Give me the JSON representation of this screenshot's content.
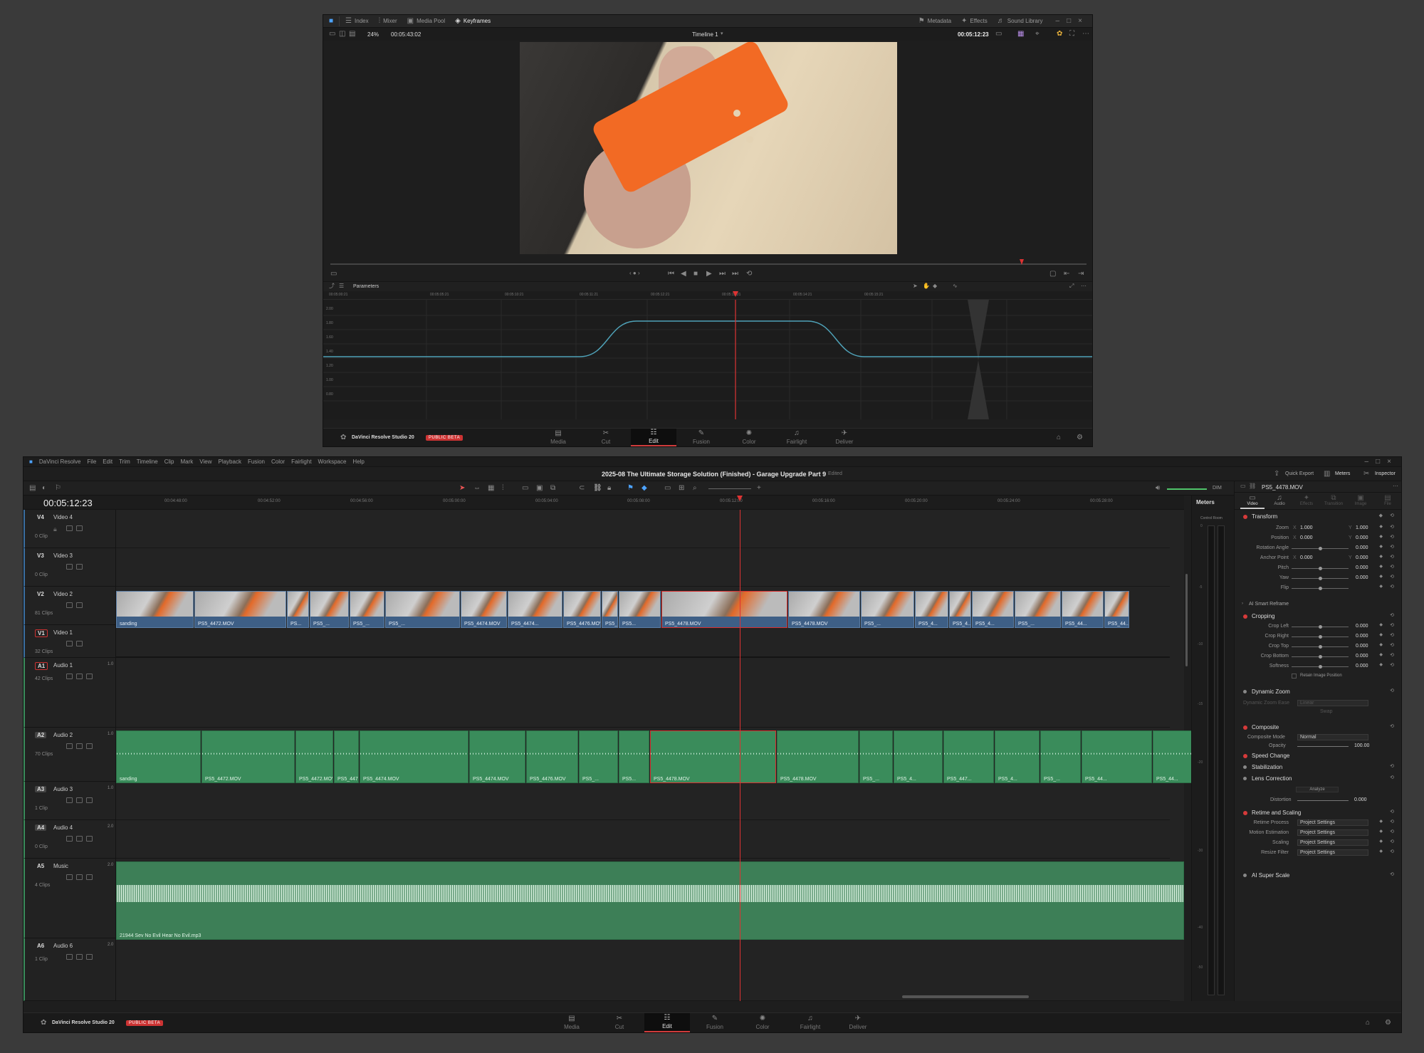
{
  "top": {
    "toolbar_left": [
      "Index",
      "Mixer",
      "Media Pool",
      "Keyframes"
    ],
    "toolbar_right": [
      "Metadata",
      "Effects",
      "Sound Library"
    ],
    "zoom": "24%",
    "source_tc": "00:05:43:02",
    "timeline_name": "Timeline 1",
    "record_tc": "00:05:12:23",
    "params_label": "Parameters",
    "ruler": [
      "00:05:00:21",
      "00:05:05:21",
      "00:05:10:21",
      "00:05:11:21",
      "00:05:12:21",
      "00:05:13:21",
      "00:05:14:21",
      "00:05:15:21"
    ],
    "yticks": [
      "2.00",
      "1.80",
      "1.60",
      "1.40",
      "1.20",
      "1.00",
      "0.80"
    ],
    "app_name": "DaVinci Resolve Studio 20",
    "badge": "PUBLIC BETA",
    "pages": [
      "Media",
      "Cut",
      "Edit",
      "Fusion",
      "Color",
      "Fairlight",
      "Deliver"
    ]
  },
  "main": {
    "menu": [
      "DaVinci Resolve",
      "File",
      "Edit",
      "Trim",
      "Timeline",
      "Clip",
      "Mark",
      "View",
      "Playback",
      "Fusion",
      "Color",
      "Fairlight",
      "Workspace",
      "Help"
    ],
    "project_title": "2025-08 The Ultimate Storage Solution (Finished) - Garage Upgrade Part 9",
    "edited": "Edited",
    "right_tools": [
      "Quick Export",
      "Meters",
      "Inspector"
    ],
    "timecode": "00:05:12:23",
    "dim": "DIM",
    "ruler": [
      "00:04:48:00",
      "00:04:52:00",
      "00:04:56:00",
      "00:05:00:00",
      "00:05:04:00",
      "00:05:08:00",
      "00:05:12:00",
      "00:05:16:00",
      "00:05:20:00",
      "00:05:24:00",
      "00:05:28:00"
    ],
    "tracks": [
      {
        "id": "V4",
        "name": "Video 4",
        "count": "0 Clip"
      },
      {
        "id": "V3",
        "name": "Video 3",
        "count": "0 Clip"
      },
      {
        "id": "V2",
        "name": "Video 2",
        "count": "81 Clips"
      },
      {
        "id": "V1",
        "name": "Video 1",
        "count": "32 Clips"
      },
      {
        "id": "A1",
        "name": "Audio 1",
        "count": "42 Clips",
        "ch": "1.0"
      },
      {
        "id": "A2",
        "name": "Audio 2",
        "count": "70 Clips",
        "ch": "1.0"
      },
      {
        "id": "A3",
        "name": "Audio 3",
        "count": "1 Clip",
        "ch": "1.0"
      },
      {
        "id": "A4",
        "name": "Audio 4",
        "count": "0 Clip",
        "ch": "2.0"
      },
      {
        "id": "A5",
        "name": "Music",
        "count": "4 Clips",
        "ch": "2.0"
      },
      {
        "id": "A6",
        "name": "Audio 6",
        "count": "1 Clip",
        "ch": "2.0"
      }
    ],
    "v2clips": [
      "sanding",
      "PS5_4472.MOV",
      "PS...",
      "PS5_...",
      "PS5_...",
      "PS5_...",
      "PS5_4474.MOV",
      "PS5_4474...",
      "PS5_4476.MOV",
      "PS5_...",
      "PS5...",
      "PS5_4478.MOV",
      "PS5_4478.MOV",
      "PS5_...",
      "PS5_4...",
      "PS5_4...",
      "PS5_4...",
      "PS5_...",
      "PS5_44...",
      "PS5_44..."
    ],
    "a2clips": [
      "sanding",
      "PS5_4472.MOV",
      "PS5_4472.MOV",
      "PS5_4474...",
      "PS5_4474.MOV",
      "PS5_4474.MOV",
      "PS5_4476.MOV",
      "PS5_...",
      "PS5...",
      "PS5_4478.MOV",
      "PS5_4478.MOV",
      "PS5_...",
      "PS5_4...",
      "PS5_447...",
      "PS5_4...",
      "PS5_...",
      "PS5_44...",
      "PS5_44..."
    ],
    "music_clip": "21944 Sev No Evil Hear No Evil.mp3",
    "meters_title": "Meters",
    "control_room": "Control Room",
    "meter_ticks": [
      "0",
      "-5",
      "-10",
      "-15",
      "-20",
      "-30",
      "-40",
      "-50"
    ]
  },
  "inspector": {
    "clip": "PS5_4478.MOV",
    "tabs": [
      "Video",
      "Audio",
      "Effects",
      "Transition",
      "Image",
      "File"
    ],
    "transform": "Transform",
    "t_rows": [
      {
        "label": "Zoom",
        "x": "1.000",
        "y": "1.000"
      },
      {
        "label": "Position",
        "x": "0.000",
        "y": "0.000"
      },
      {
        "label": "Rotation Angle",
        "v": "0.000"
      },
      {
        "label": "Anchor Point",
        "x": "0.000",
        "y": "0.000"
      },
      {
        "label": "Pitch",
        "v": "0.000"
      },
      {
        "label": "Yaw",
        "v": "0.000"
      },
      {
        "label": "Flip",
        "v": ""
      }
    ],
    "ai_reframe": "AI Smart Reframe",
    "cropping": "Cropping",
    "c_rows": [
      {
        "label": "Crop Left",
        "v": "0.000"
      },
      {
        "label": "Crop Right",
        "v": "0.000"
      },
      {
        "label": "Crop Top",
        "v": "0.000"
      },
      {
        "label": "Crop Bottom",
        "v": "0.000"
      },
      {
        "label": "Softness",
        "v": "0.000"
      }
    ],
    "retain": "Retain Image Position",
    "dynamic_zoom": "Dynamic Zoom",
    "dz_ease": "Dynamic Zoom Ease",
    "dz_ease_val": "Linear",
    "swap": "Swap",
    "composite": "Composite",
    "comp_mode_label": "Composite Mode",
    "comp_mode": "Normal",
    "opacity_label": "Opacity",
    "opacity": "100.00",
    "speed_change": "Speed Change",
    "stabilization": "Stabilization",
    "lens": "Lens Correction",
    "analyze": "Analyze",
    "distortion_label": "Distortion",
    "distortion": "0.000",
    "retime": "Retime and Scaling",
    "r_rows": [
      {
        "label": "Retime Process",
        "v": "Project Settings"
      },
      {
        "label": "Motion Estimation",
        "v": "Project Settings"
      },
      {
        "label": "Scaling",
        "v": "Project Settings"
      },
      {
        "label": "Resize Filter",
        "v": "Project Settings"
      }
    ],
    "super_scale": "AI Super Scale"
  },
  "bottom": {
    "app_name": "DaVinci Resolve Studio 20",
    "badge": "PUBLIC BETA",
    "pages": [
      "Media",
      "Cut",
      "Edit",
      "Fusion",
      "Color",
      "Fairlight",
      "Deliver"
    ]
  }
}
